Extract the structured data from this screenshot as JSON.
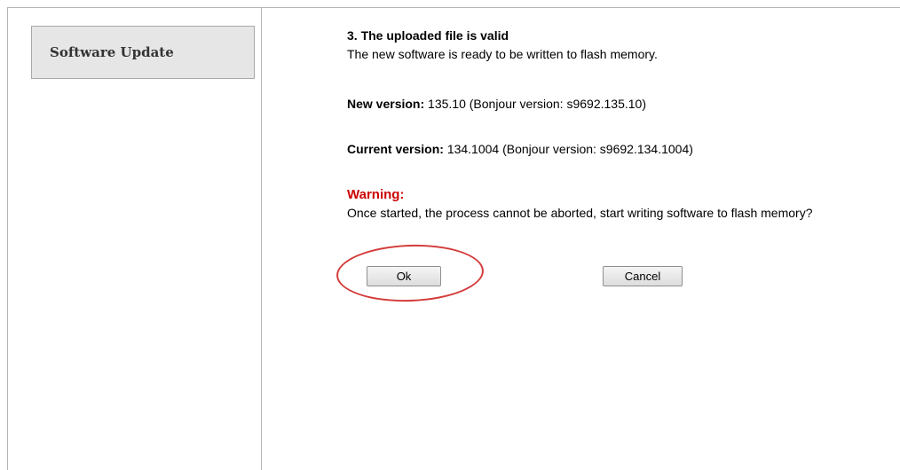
{
  "sidebar": {
    "items": [
      {
        "label": "Software Update"
      }
    ]
  },
  "main": {
    "step_title": "3. The uploaded file is valid",
    "step_description": "The new software is ready to be written to flash memory.",
    "new_version": {
      "label": "New version:",
      "value": "135.10 (Bonjour version: s9692.135.10)"
    },
    "current_version": {
      "label": "Current version:",
      "value": "134.1004 (Bonjour version: s9692.134.1004)"
    },
    "warning": {
      "title": "Warning:",
      "text": "Once started, the process cannot be aborted, start writing software to flash memory?"
    },
    "buttons": {
      "ok_label": "Ok",
      "cancel_label": "Cancel"
    }
  },
  "colors": {
    "warning": "#cc0000",
    "highlight_circle": "#d43a3a",
    "nav_box_bg": "#e6e6e6"
  }
}
